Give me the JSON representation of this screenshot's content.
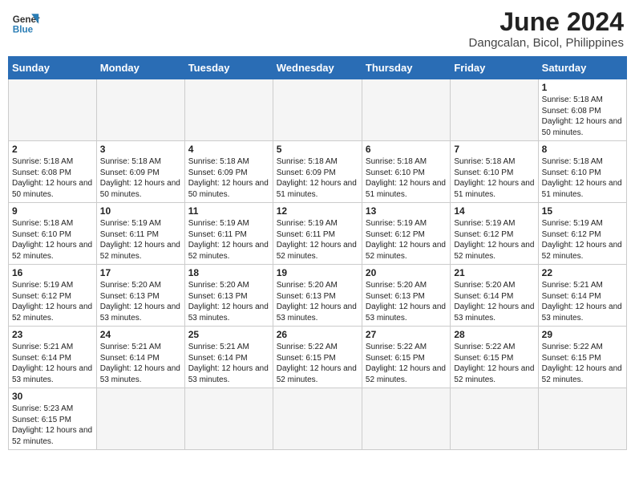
{
  "header": {
    "logo_general": "General",
    "logo_blue": "Blue",
    "month_year": "June 2024",
    "location": "Dangcalan, Bicol, Philippines"
  },
  "days_of_week": [
    "Sunday",
    "Monday",
    "Tuesday",
    "Wednesday",
    "Thursday",
    "Friday",
    "Saturday"
  ],
  "weeks": [
    [
      {
        "day": "",
        "info": ""
      },
      {
        "day": "",
        "info": ""
      },
      {
        "day": "",
        "info": ""
      },
      {
        "day": "",
        "info": ""
      },
      {
        "day": "",
        "info": ""
      },
      {
        "day": "",
        "info": ""
      },
      {
        "day": "1",
        "info": "Sunrise: 5:18 AM\nSunset: 6:08 PM\nDaylight: 12 hours and 50 minutes."
      }
    ],
    [
      {
        "day": "2",
        "info": "Sunrise: 5:18 AM\nSunset: 6:08 PM\nDaylight: 12 hours and 50 minutes."
      },
      {
        "day": "3",
        "info": "Sunrise: 5:18 AM\nSunset: 6:09 PM\nDaylight: 12 hours and 50 minutes."
      },
      {
        "day": "4",
        "info": "Sunrise: 5:18 AM\nSunset: 6:09 PM\nDaylight: 12 hours and 50 minutes."
      },
      {
        "day": "5",
        "info": "Sunrise: 5:18 AM\nSunset: 6:09 PM\nDaylight: 12 hours and 51 minutes."
      },
      {
        "day": "6",
        "info": "Sunrise: 5:18 AM\nSunset: 6:10 PM\nDaylight: 12 hours and 51 minutes."
      },
      {
        "day": "7",
        "info": "Sunrise: 5:18 AM\nSunset: 6:10 PM\nDaylight: 12 hours and 51 minutes."
      },
      {
        "day": "8",
        "info": "Sunrise: 5:18 AM\nSunset: 6:10 PM\nDaylight: 12 hours and 51 minutes."
      }
    ],
    [
      {
        "day": "9",
        "info": "Sunrise: 5:18 AM\nSunset: 6:10 PM\nDaylight: 12 hours and 52 minutes."
      },
      {
        "day": "10",
        "info": "Sunrise: 5:19 AM\nSunset: 6:11 PM\nDaylight: 12 hours and 52 minutes."
      },
      {
        "day": "11",
        "info": "Sunrise: 5:19 AM\nSunset: 6:11 PM\nDaylight: 12 hours and 52 minutes."
      },
      {
        "day": "12",
        "info": "Sunrise: 5:19 AM\nSunset: 6:11 PM\nDaylight: 12 hours and 52 minutes."
      },
      {
        "day": "13",
        "info": "Sunrise: 5:19 AM\nSunset: 6:12 PM\nDaylight: 12 hours and 52 minutes."
      },
      {
        "day": "14",
        "info": "Sunrise: 5:19 AM\nSunset: 6:12 PM\nDaylight: 12 hours and 52 minutes."
      },
      {
        "day": "15",
        "info": "Sunrise: 5:19 AM\nSunset: 6:12 PM\nDaylight: 12 hours and 52 minutes."
      }
    ],
    [
      {
        "day": "16",
        "info": "Sunrise: 5:19 AM\nSunset: 6:12 PM\nDaylight: 12 hours and 52 minutes."
      },
      {
        "day": "17",
        "info": "Sunrise: 5:20 AM\nSunset: 6:13 PM\nDaylight: 12 hours and 53 minutes."
      },
      {
        "day": "18",
        "info": "Sunrise: 5:20 AM\nSunset: 6:13 PM\nDaylight: 12 hours and 53 minutes."
      },
      {
        "day": "19",
        "info": "Sunrise: 5:20 AM\nSunset: 6:13 PM\nDaylight: 12 hours and 53 minutes."
      },
      {
        "day": "20",
        "info": "Sunrise: 5:20 AM\nSunset: 6:13 PM\nDaylight: 12 hours and 53 minutes."
      },
      {
        "day": "21",
        "info": "Sunrise: 5:20 AM\nSunset: 6:14 PM\nDaylight: 12 hours and 53 minutes."
      },
      {
        "day": "22",
        "info": "Sunrise: 5:21 AM\nSunset: 6:14 PM\nDaylight: 12 hours and 53 minutes."
      }
    ],
    [
      {
        "day": "23",
        "info": "Sunrise: 5:21 AM\nSunset: 6:14 PM\nDaylight: 12 hours and 53 minutes."
      },
      {
        "day": "24",
        "info": "Sunrise: 5:21 AM\nSunset: 6:14 PM\nDaylight: 12 hours and 53 minutes."
      },
      {
        "day": "25",
        "info": "Sunrise: 5:21 AM\nSunset: 6:14 PM\nDaylight: 12 hours and 53 minutes."
      },
      {
        "day": "26",
        "info": "Sunrise: 5:22 AM\nSunset: 6:15 PM\nDaylight: 12 hours and 52 minutes."
      },
      {
        "day": "27",
        "info": "Sunrise: 5:22 AM\nSunset: 6:15 PM\nDaylight: 12 hours and 52 minutes."
      },
      {
        "day": "28",
        "info": "Sunrise: 5:22 AM\nSunset: 6:15 PM\nDaylight: 12 hours and 52 minutes."
      },
      {
        "day": "29",
        "info": "Sunrise: 5:22 AM\nSunset: 6:15 PM\nDaylight: 12 hours and 52 minutes."
      }
    ],
    [
      {
        "day": "30",
        "info": "Sunrise: 5:23 AM\nSunset: 6:15 PM\nDaylight: 12 hours and 52 minutes."
      },
      {
        "day": "",
        "info": ""
      },
      {
        "day": "",
        "info": ""
      },
      {
        "day": "",
        "info": ""
      },
      {
        "day": "",
        "info": ""
      },
      {
        "day": "",
        "info": ""
      },
      {
        "day": "",
        "info": ""
      }
    ]
  ]
}
